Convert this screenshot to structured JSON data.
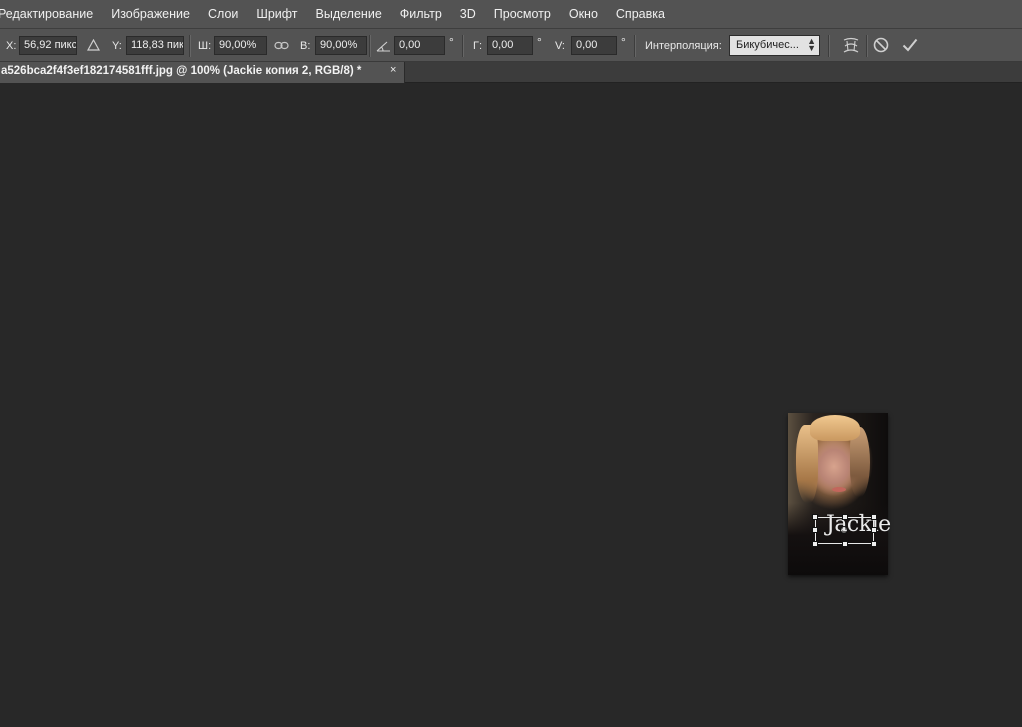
{
  "menu": [
    "Редактирование",
    "Изображение",
    "Слои",
    "Шрифт",
    "Выделение",
    "Фильтр",
    "3D",
    "Просмотр",
    "Окно",
    "Справка"
  ],
  "options": {
    "x_label": "X:",
    "x_value": "56,92 пикс",
    "y_label": "Y:",
    "y_value": "118,83 пикс",
    "w_label": "Ш:",
    "w_value": "90,00%",
    "h_label": "В:",
    "h_value": "90,00%",
    "angle_value": "0,00",
    "hskew_label": "Г:",
    "hskew_value": "0,00",
    "vskew_label": "V:",
    "vskew_value": "0,00",
    "degree_symbol": "°",
    "interp_label": "Интерполяция:",
    "interp_value": "Бикубичес...",
    "icons": [
      "triangle-icon",
      "link-icon",
      "angle-icon",
      "warp-icon",
      "cancel-icon",
      "commit-check-icon"
    ]
  },
  "document": {
    "tab_title": "a526bca2f4f3ef182174581fff.jpg @ 100% (Jackie копия 2, RGB/8) *",
    "close_glyph": "×",
    "overlay_text": "Jackie"
  },
  "colors": {
    "menubar_bg": "#535353",
    "canvas_bg": "#282828",
    "tab_bg": "#535353"
  }
}
